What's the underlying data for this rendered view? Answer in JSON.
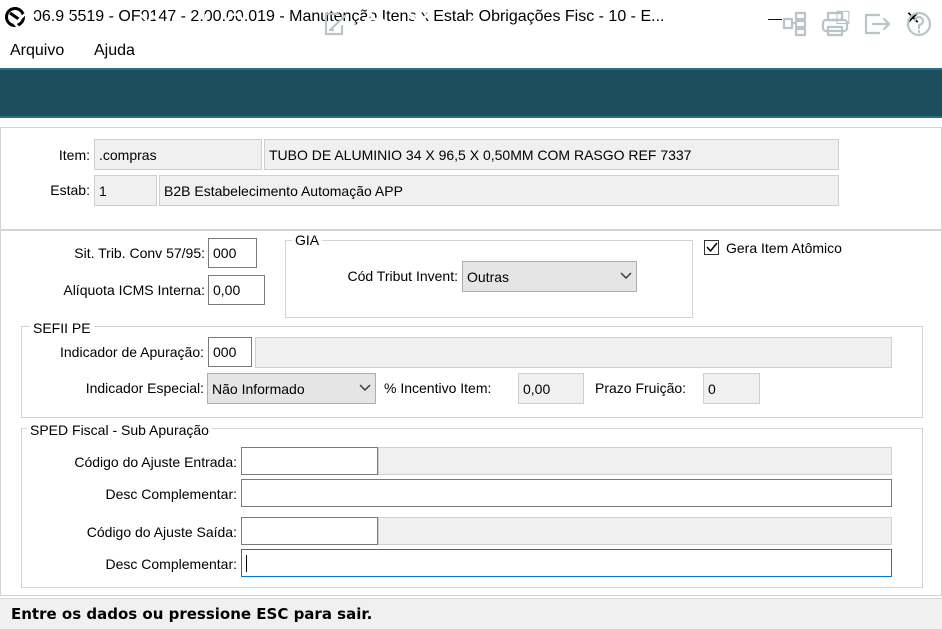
{
  "window": {
    "title": "06.9.5519 - OF0147 - 2.00.00.019 - Manutenção Itens x Estab Obrigações Fisc - 10 - E...",
    "minimize_glyph": "—",
    "maximize_glyph": "☐",
    "close_glyph": "✕"
  },
  "menu": {
    "items": [
      "Arquivo",
      "Ajuda"
    ]
  },
  "toolbar": {
    "icons": [
      "first-icon",
      "prev-icon",
      "next-icon",
      "last-icon",
      "goto-icon",
      "search-icon",
      "edit-icon",
      "undo-icon",
      "cancel-icon",
      "confirm-icon",
      "hierarchy-icon",
      "print-icon",
      "exit-icon",
      "help-icon"
    ]
  },
  "header": {
    "item_label": "Item:",
    "item_code": ".compras",
    "item_desc": "TUBO DE ALUMINIO 34 X 96,5 X 0,50MM COM RASGO REF 7337",
    "estab_label": "Estab:",
    "estab_code": "1",
    "estab_desc": "B2B  Estabelecimento Automação APP"
  },
  "icms": {
    "sit_trib_label": "Sit. Trib. Conv 57/95:",
    "sit_trib_value": "000",
    "aliquota_label": "Alíquota ICMS Interna:",
    "aliquota_value": "0,00"
  },
  "gia": {
    "group_label": "GIA",
    "cod_tribut_label": "Cód Tribut Invent:",
    "cod_tribut_value": "Outras"
  },
  "gera_item": {
    "label": "Gera Item Atômico",
    "checked": true
  },
  "sefii": {
    "group_label": "SEFII PE",
    "ind_apuracao_label": "Indicador de Apuração:",
    "ind_apuracao_value": "000",
    "ind_apuracao_desc": "",
    "ind_especial_label": "Indicador Especial:",
    "ind_especial_value": "Não Informado",
    "incentivo_label": "% Incentivo Item:",
    "incentivo_value": "0,00",
    "prazo_label": "Prazo Fruição:",
    "prazo_value": "0"
  },
  "sped": {
    "group_label": "SPED Fiscal - Sub Apuração",
    "ajuste_entrada_label": "Código do Ajuste Entrada:",
    "ajuste_entrada_value": "",
    "ajuste_entrada_desc": "",
    "desc_compl_entrada_label": "Desc Complementar:",
    "desc_compl_entrada_value": "",
    "ajuste_saida_label": "Código do Ajuste Saída:",
    "ajuste_saida_value": "",
    "ajuste_saida_desc": "",
    "desc_compl_saida_label": "Desc Complementar:",
    "desc_compl_saida_value": ""
  },
  "status": {
    "message": "Entre os dados ou pressione ESC para sair."
  },
  "colors": {
    "toolbar_bg": "#1d4e5e",
    "focus_border": "#0078d7"
  }
}
